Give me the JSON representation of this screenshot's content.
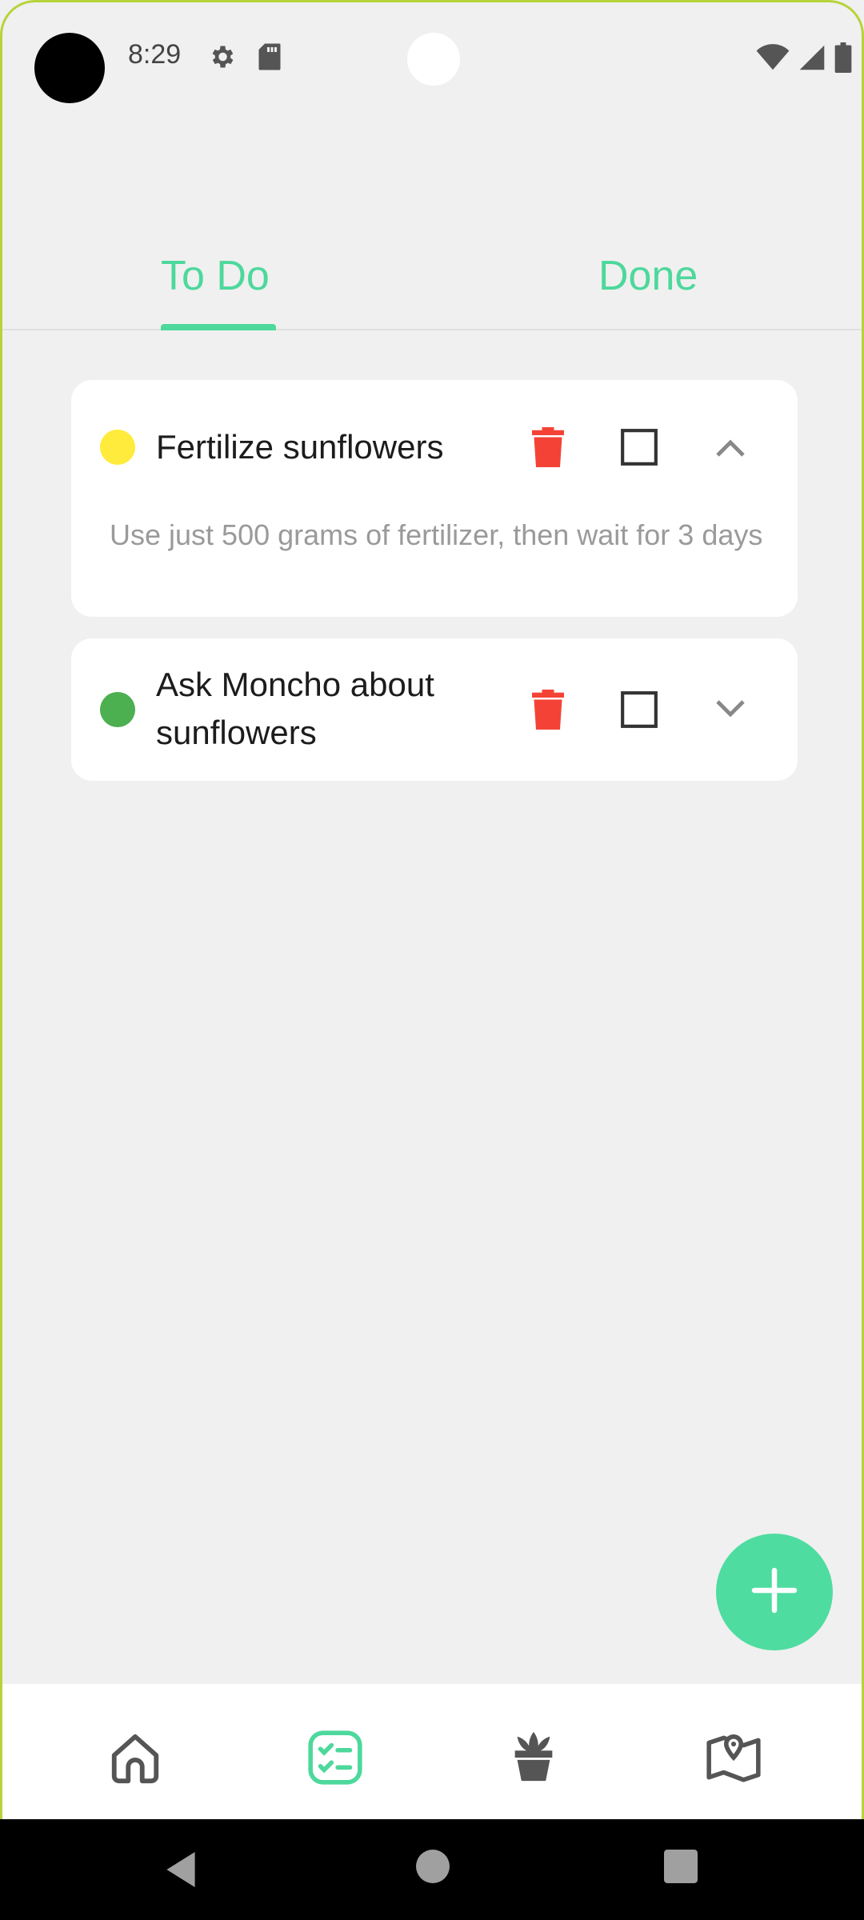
{
  "status_bar": {
    "time": "8:29",
    "left_icons": [
      "gear-icon",
      "sd-card-icon"
    ],
    "right_icons": [
      "wifi-icon",
      "signal-icon",
      "battery-icon"
    ]
  },
  "tabs": [
    {
      "label": "To Do",
      "selected": true
    },
    {
      "label": "Done",
      "selected": false
    }
  ],
  "tasks": [
    {
      "title": "Fertilize sunflowers",
      "priority_color": "#ffeb3b",
      "description": "Use just 500 grams of fertilizer, then wait for 3 days",
      "expanded": true,
      "checked": false
    },
    {
      "title": "Ask Moncho about sunflowers",
      "priority_color": "#4caf50",
      "description": "",
      "expanded": false,
      "checked": false
    }
  ],
  "fab": {
    "icon": "plus-icon"
  },
  "bottom_nav": [
    {
      "icon": "home-icon",
      "active": false
    },
    {
      "icon": "tasks-icon",
      "active": true
    },
    {
      "icon": "plant-icon",
      "active": false
    },
    {
      "icon": "map-icon",
      "active": false
    }
  ],
  "colors": {
    "accent": "#4dd89c",
    "delete": "#f44336",
    "background": "#f0f0f0",
    "icon_gray": "#555555"
  }
}
